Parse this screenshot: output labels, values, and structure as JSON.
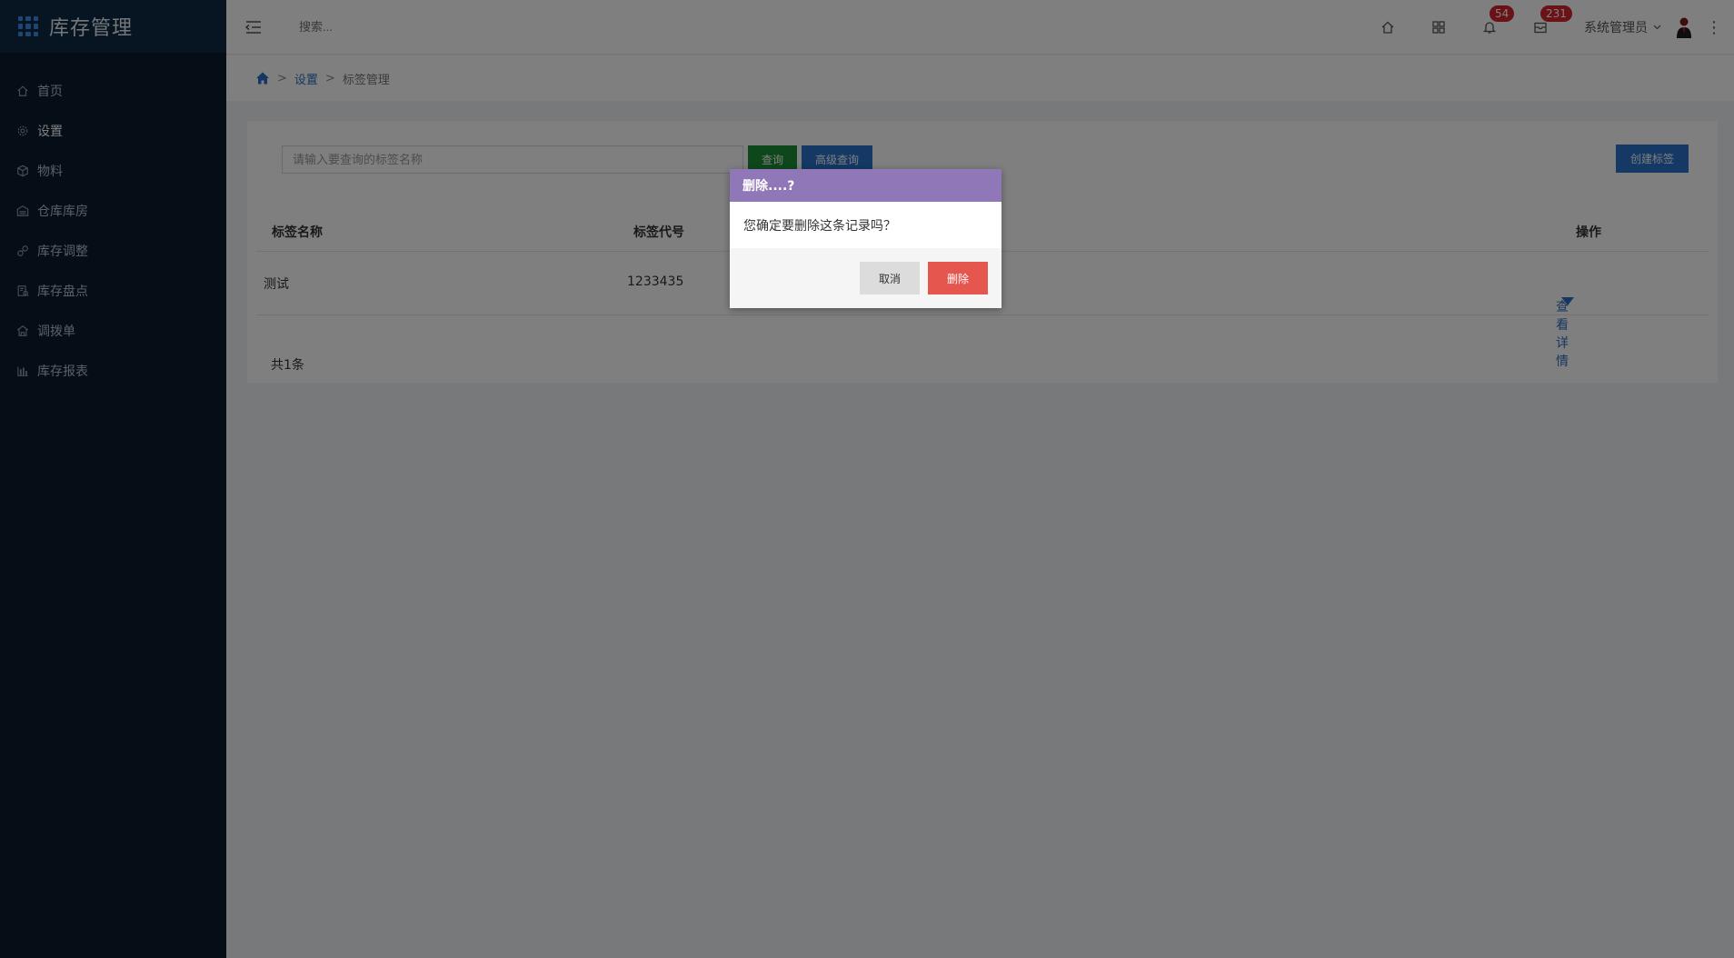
{
  "app": {
    "title": "库存管理"
  },
  "sidebar": {
    "items": [
      {
        "label": "首页",
        "icon": "home-icon"
      },
      {
        "label": "设置",
        "icon": "gear-icon"
      },
      {
        "label": "物料",
        "icon": "cube-icon"
      },
      {
        "label": "仓库库房",
        "icon": "warehouse-icon"
      },
      {
        "label": "库存调整",
        "icon": "adjust-icon"
      },
      {
        "label": "库存盘点",
        "icon": "inventory-check-icon"
      },
      {
        "label": "调拨单",
        "icon": "transfer-icon"
      },
      {
        "label": "库存报表",
        "icon": "bar-chart-icon"
      }
    ],
    "active_index": 1
  },
  "topbar": {
    "search_placeholder": "搜索...",
    "notifications_count": "54",
    "messages_count": "231",
    "user_name": "系统管理员"
  },
  "breadcrumb": {
    "settings": "设置",
    "current": "标签管理"
  },
  "panel": {
    "search_placeholder": "请输入要查询的标签名称",
    "query_label": "查询",
    "advanced_query_label": "高级查询",
    "create_label": "创建标签",
    "columns": [
      "标签名称",
      "标签代号",
      "操作"
    ],
    "rows": [
      {
        "name": "测试",
        "code": "1233435",
        "action": "查看详情"
      }
    ],
    "total": "共1条"
  },
  "dialog": {
    "title": "删除....?",
    "message": "您确定要删除这条记录吗？",
    "cancel_label": "取消",
    "delete_label": "删除"
  },
  "colors": {
    "sidebar_bg": "#0b1a2c",
    "brand_bg": "#0e2a47",
    "primary": "#2872c9",
    "success": "#1f8f38",
    "danger": "#e5564f",
    "dialog_header": "#8f77b8",
    "badge": "#d6242c"
  }
}
